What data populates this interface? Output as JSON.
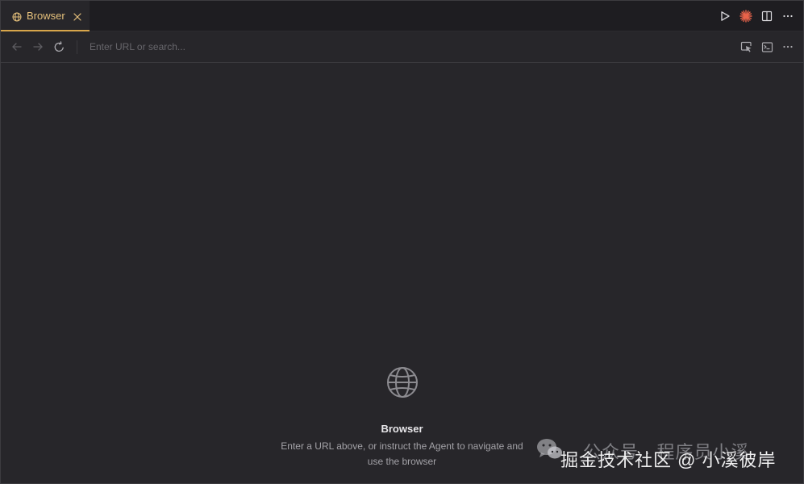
{
  "tab": {
    "label": "Browser",
    "accent": "#e5c07b",
    "icon": "globe-icon",
    "close_icon": "close-icon"
  },
  "title_actions": [
    {
      "icon": "play-icon"
    },
    {
      "icon": "agent-spark-icon",
      "color": "#e8634a"
    },
    {
      "icon": "split-editor-icon"
    },
    {
      "icon": "more-icon"
    }
  ],
  "nav": {
    "back_icon": "arrow-left-icon",
    "forward_icon": "arrow-right-icon",
    "reload_icon": "reload-icon",
    "url_placeholder": "Enter URL or search...",
    "url_value": ""
  },
  "tools": [
    {
      "icon": "select-element-icon"
    },
    {
      "icon": "console-icon"
    },
    {
      "icon": "more-icon"
    }
  ],
  "empty_state": {
    "icon": "globe-icon",
    "title": "Browser",
    "description": "Enter a URL above, or instruct the Agent to navigate and use the browser"
  },
  "watermark": {
    "logo": "wechat-logo",
    "line1": "公众号 · 程序员小溪",
    "line2": "掘金技术社区 @ 小溪彼岸"
  },
  "colors": {
    "background": "#27262a",
    "tabbar": "#1e1d21",
    "tab_accent": "#d8a64b",
    "text_primary": "#e8e7ea",
    "text_secondary": "#a3a2a7"
  }
}
